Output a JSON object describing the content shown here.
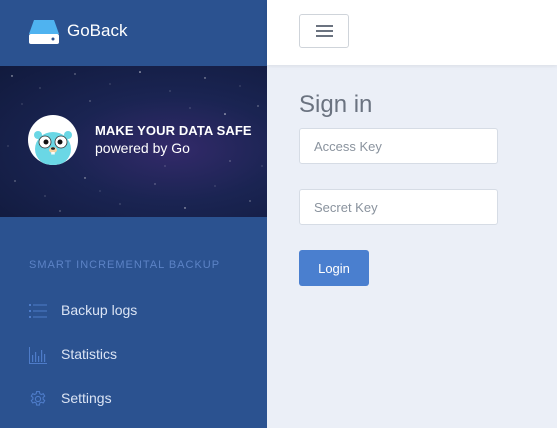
{
  "brand": {
    "name": "GoBack",
    "logo_icon": "drive-icon"
  },
  "hero": {
    "tagline": "MAKE YOUR DATA SAFE",
    "subtitle": "powered by Go",
    "avatar_icon": "gopher-avatar-icon"
  },
  "sidebar": {
    "section_title": "SMART INCREMENTAL BACKUP",
    "items": [
      {
        "label": "Backup logs",
        "icon": "list-icon"
      },
      {
        "label": "Statistics",
        "icon": "bar-chart-icon"
      },
      {
        "label": "Settings",
        "icon": "gear-icon"
      }
    ]
  },
  "topbar": {
    "menu_icon": "hamburger-icon"
  },
  "main": {
    "title": "Sign in",
    "access_key": {
      "value": "",
      "placeholder": "Access Key"
    },
    "secret_key": {
      "value": "",
      "placeholder": "Secret Key"
    },
    "login_label": "Login"
  },
  "colors": {
    "sidebar_bg": "#2b5290",
    "accent": "#4a7fcf",
    "section_title": "#5c83c6",
    "page_bg": "#ebeff7"
  }
}
